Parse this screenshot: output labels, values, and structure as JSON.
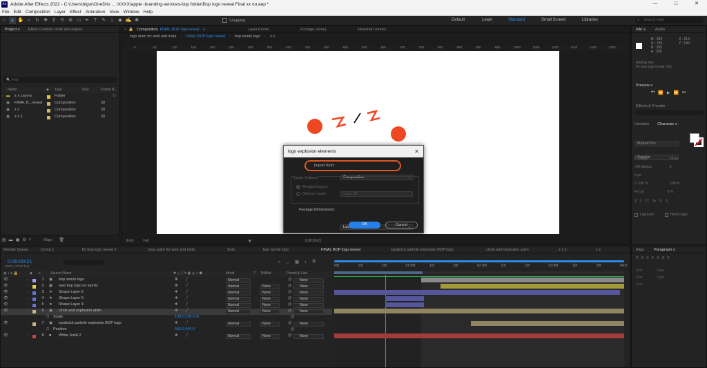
{
  "app": {
    "badge": "Ae",
    "title": "Adobe After Effects 2022 - C:\\Users\\bigor\\OneDriv ... \\XXXX\\apple -branding-services-bop folder\\Bop logo reveal Final xx no.aep *",
    "window_controls": [
      "—",
      "□",
      "✕"
    ]
  },
  "menu": [
    "File",
    "Edit",
    "Composition",
    "Layer",
    "Effect",
    "Animation",
    "View",
    "Window",
    "Help"
  ],
  "toolbar": {
    "snapping_label": "Snapping",
    "workspaces": [
      "Default",
      "Learn",
      "Standard",
      "Small Screen",
      "Libraries"
    ],
    "active_workspace": "Standard",
    "search_placeholder": "Search Help",
    "tools": [
      "home-icon",
      "selection-icon",
      "hand-icon",
      "zoom-icon",
      "orbit-icon",
      "pan-icon",
      "dolly-icon",
      "rotate-icon",
      "anchor-icon",
      "rect-icon",
      "pen-icon",
      "type-icon",
      "brush-icon",
      "clone-icon",
      "eraser-icon",
      "roto-icon",
      "puppet-icon"
    ]
  },
  "project_panel": {
    "tabs": [
      "Project ≡",
      "Effect Controls circle and explos"
    ],
    "search_placeholder": "🔍 Find",
    "columns": [
      "Name",
      "Type",
      "Size",
      "Frame R..."
    ],
    "items": [
      {
        "name": "z x Layers",
        "type": "Folder",
        "rate": "",
        "color": "#e8c440"
      },
      {
        "name": "FINAL B...reveal",
        "type": "Composition",
        "rate": "30",
        "color": "#d1b772"
      },
      {
        "name": "z x",
        "type": "Composition",
        "rate": "30",
        "color": "#d1b772"
      },
      {
        "name": "z x 2",
        "type": "Composition",
        "rate": "30",
        "color": "#d1b772"
      }
    ],
    "bpc": "8 bpc"
  },
  "comp_panel": {
    "tab_prefix": "Composition",
    "tab_name": "FINAL BOP logo reveal",
    "other_tabs": [
      "Layer (none)",
      "Footage (none)",
      "Flowchart (none)"
    ],
    "breadcrumbs": [
      "logo anim for web and insta",
      "FINAL BOP logo reveal",
      "bop words logo",
      "z x"
    ],
    "ruler_ticks": [
      "0",
      "50",
      "100",
      "150",
      "200",
      "250",
      "300",
      "350",
      "400",
      "450",
      "500",
      "550",
      "600",
      "650",
      "700",
      "750",
      "800",
      "850",
      "900",
      "950",
      "1000",
      "1050",
      "1100",
      "1150",
      "1200",
      "1250"
    ],
    "footer": {
      "zoom": "(Full)",
      "time": "0;00;00;21",
      "resolution": "Full"
    }
  },
  "dialog": {
    "title": "logo explosion elements",
    "import_kind_label": "Import Kind:",
    "import_kind_value": "Composition",
    "layer_options_label": "Layer Options",
    "merged_layers": "Merged Layers",
    "choose_layer": "Choose Layer:",
    "choose_layer_value": "Layer 34",
    "footage_dim_label": "Footage Dimensions:",
    "footage_dim_value": "Layer Size",
    "ok": "OK",
    "cancel": "Cancel"
  },
  "right_panel": {
    "info_tabs": [
      "Info ≡",
      "Audio"
    ],
    "rgb": [
      "R : 255",
      "G : 255",
      "B : 255",
      "A : 255"
    ],
    "xy": [
      "X : 214",
      "Y : 190"
    ],
    "info_lines": [
      "Adding files",
      "for bop logo reveal (10)"
    ],
    "preview_label": "Preview ≡",
    "effects_label": "Effects & Presets",
    "libraries_label": "Libraries",
    "character_label": "Character ≡",
    "font": "Myriad Pro",
    "font_style": "Regular",
    "size": "104 px",
    "leading": "24 px",
    "kerning": "Metrics",
    "tracking": "0",
    "tsize": "px",
    "scale_v": "100 %",
    "scale_h": "100 %",
    "baseline": "0 px",
    "tsume": "0 %",
    "ligatures": "Ligatures",
    "hindi_digits": "Hindi Digits",
    "align_tabs": [
      "Align",
      "Paragraph ≡"
    ],
    "para_values": [
      "0 px",
      "0 px",
      "0 px",
      "0 px",
      "0 px"
    ]
  },
  "timeline": {
    "tabs": [
      "Comp 1",
      "fin bop logo reveal 2",
      "logo anim for web and insta",
      "Solo",
      "bop words logo",
      "FINAL BOP logo reveal",
      "spubnick particle explosion BOP logo",
      "circle and explosion anim",
      "z x 2",
      "z x"
    ],
    "active_tab": "FINAL BOP logo reveal",
    "render_queue": "Render Queue",
    "current_time": "0:00:00:21",
    "frame_info": "00021 (30.00 fps)",
    "columns": {
      "source": "Source Name",
      "mode": "Mode",
      "t": "T",
      "trkmat": "TrkMat",
      "parent": "Parent & Link"
    },
    "layers": [
      {
        "num": "1",
        "name": "bop words logo",
        "color": "#a1a1e6",
        "mode": "Normal",
        "trk": "",
        "parent": "None",
        "kind": "comp"
      },
      {
        "num": "2",
        "name": "new bop logo no words",
        "color": "#e0d34c",
        "mode": "Normal",
        "trk": "None",
        "parent": "None",
        "kind": "comp"
      },
      {
        "num": "3",
        "name": "Shape Layer 6",
        "color": "#6670d6",
        "mode": "Normal",
        "trk": "None",
        "parent": "None",
        "kind": "shape"
      },
      {
        "num": "4",
        "name": "Shape Layer 5",
        "color": "#6670d6",
        "mode": "Normal",
        "trk": "None",
        "parent": "None",
        "kind": "shape"
      },
      {
        "num": "5",
        "name": "Shape Layer 4",
        "color": "#6670d6",
        "mode": "Normal",
        "trk": "None",
        "parent": "None",
        "kind": "shape"
      },
      {
        "num": "6",
        "name": "circle and explosion anim",
        "color": "#c9b58a",
        "mode": "Normal",
        "trk": "None",
        "parent": "None",
        "kind": "comp"
      },
      {
        "num": "",
        "name": "Scale",
        "color": "",
        "mode": "",
        "trk": "",
        "parent": "",
        "kind": "prop",
        "value": "138.0,138.0 %"
      },
      {
        "num": "7",
        "name": "spubnick particle explosion BOP logo",
        "color": "#c9b58a",
        "mode": "Normal",
        "trk": "None",
        "parent": "None",
        "kind": "comp"
      },
      {
        "num": "",
        "name": "Position",
        "color": "",
        "mode": "",
        "trk": "",
        "parent": "",
        "kind": "prop",
        "value": "566.0,440.0"
      },
      {
        "num": "8",
        "name": "White Solid 2",
        "color": "#cc4848",
        "mode": "Normal",
        "trk": "None",
        "parent": "None",
        "kind": "solid"
      }
    ],
    "time_ruler": [
      "00f",
      "10f",
      "20f",
      "01:00f",
      "10f",
      "20f",
      "02:00f",
      "10f",
      "20f",
      "03:00f",
      "10f",
      "20f",
      "04:0"
    ]
  }
}
